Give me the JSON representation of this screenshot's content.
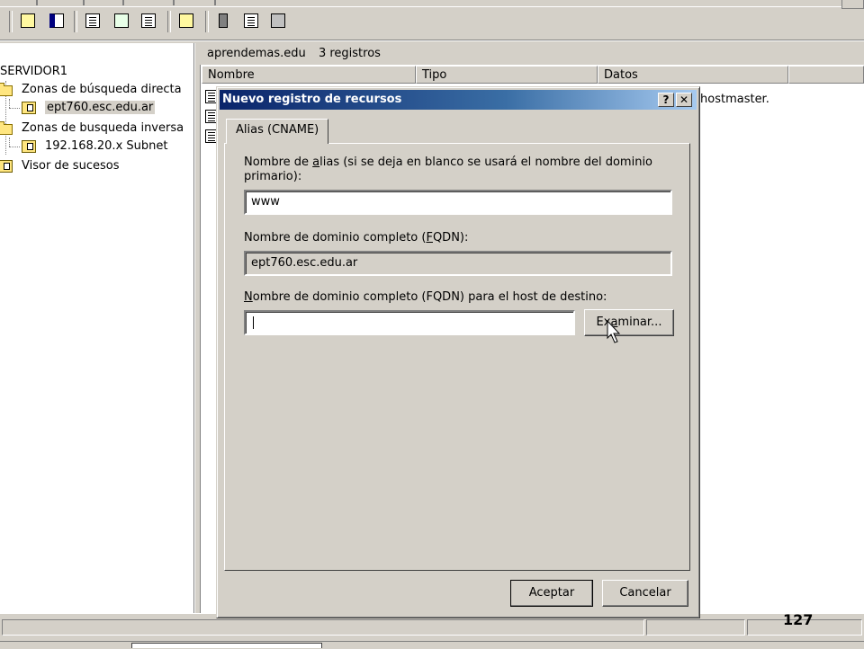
{
  "tree": {
    "root": "SERVIDOR1",
    "items": [
      {
        "label": "Zonas de búsqueda directa"
      },
      {
        "label": "ept760.esc.edu.ar"
      },
      {
        "label": "Zonas de busqueda inversa"
      },
      {
        "label": "192.168.20.x Subnet"
      },
      {
        "label": "Visor de sucesos"
      }
    ]
  },
  "rightpane": {
    "header": "aprendemas.edu",
    "count": "3 registros",
    "columns": [
      "Nombre",
      "Tipo",
      "Datos"
    ],
    "partial_data": "hostmaster."
  },
  "dialog": {
    "title": "Nuevo registro de recursos",
    "help_btn": "?",
    "close_btn": "✕",
    "tab": "Alias (CNAME)",
    "alias_label_pre": "Nombre de ",
    "alias_label_ul": "a",
    "alias_label_post": "lias (si se deja en blanco se usará el nombre del dominio primario):",
    "alias_value": "www",
    "fqdn_label_pre": "Nombre de dominio completo (",
    "fqdn_label_ul": "F",
    "fqdn_label_post": "QDN):",
    "fqdn_value": "ept760.esc.edu.ar",
    "target_label_pre": "",
    "target_label_ul": "N",
    "target_label_post": "ombre de dominio completo (FQDN) para el host de destino:",
    "target_value": "",
    "browse_pre": "Ex",
    "browse_ul": "a",
    "browse_post": "minar...",
    "ok": "Aceptar",
    "cancel": "Cancelar"
  },
  "page_number": "127"
}
